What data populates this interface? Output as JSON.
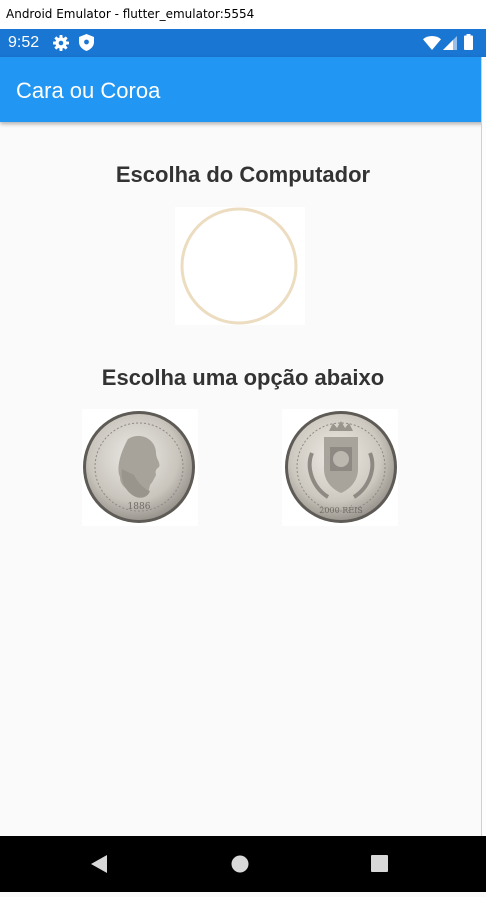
{
  "window": {
    "title": "Android Emulator - flutter_emulator:5554"
  },
  "status_bar": {
    "time": "9:52",
    "icons": [
      "gear-icon",
      "shield-icon",
      "wifi-icon",
      "signal-icon",
      "battery-icon"
    ],
    "color": "#1976d2"
  },
  "app_bar": {
    "title": "Cara ou Coroa",
    "color": "#2196f3"
  },
  "main": {
    "computer_heading": "Escolha do Computador",
    "options_heading": "Escolha uma opção abaixo",
    "options": [
      {
        "name": "heads",
        "icon": "coin-heads-icon"
      },
      {
        "name": "tails",
        "icon": "coin-tails-icon"
      }
    ],
    "computer_coin_ring_color": "#ecdcc0"
  },
  "nav_bar": {
    "buttons": [
      "back-icon",
      "home-icon",
      "recent-apps-icon"
    ]
  }
}
